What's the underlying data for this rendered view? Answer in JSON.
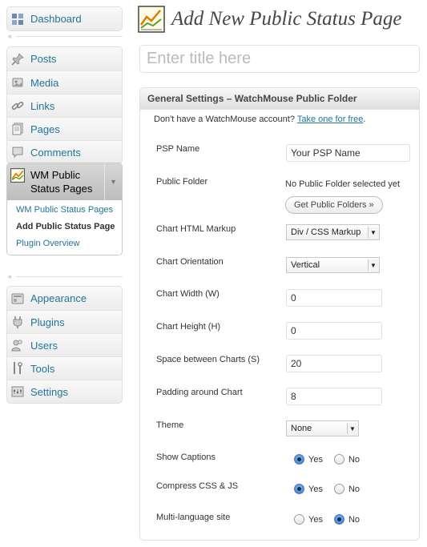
{
  "sidebar": {
    "dashboard": "Dashboard",
    "posts": "Posts",
    "media": "Media",
    "links": "Links",
    "pages": "Pages",
    "comments": "Comments",
    "wm_menu": {
      "label": "WM Public Status Pages",
      "submenu": [
        "WM Public Status Pages",
        "Add Public Status Page",
        "Plugin Overview"
      ],
      "current": "Add Public Status Page"
    },
    "appearance": "Appearance",
    "plugins": "Plugins",
    "users": "Users",
    "tools": "Tools",
    "settings": "Settings"
  },
  "page": {
    "title": "Add New Public Status Page",
    "title_placeholder": "Enter title here"
  },
  "general_settings": {
    "heading": "General Settings – WatchMouse Public Folder",
    "account_note": "Don't have a WatchMouse account?",
    "account_link": "Take one for free",
    "account_suffix": ".",
    "fields": {
      "psp_name": {
        "label": "PSP Name",
        "value": "Your PSP Name"
      },
      "public_folder": {
        "label": "Public Folder",
        "status": "No Public Folder selected yet",
        "button": "Get Public Folders »"
      },
      "chart_markup": {
        "label": "Chart HTML Markup",
        "value": "Div / CSS Markup"
      },
      "chart_orientation": {
        "label": "Chart Orientation",
        "value": "Vertical"
      },
      "chart_width": {
        "label": "Chart Width (W)",
        "value": "0"
      },
      "chart_height": {
        "label": "Chart Height (H)",
        "value": "0"
      },
      "space_between": {
        "label": "Space between Charts (S)",
        "value": "20"
      },
      "padding": {
        "label": "Padding around Chart",
        "value": "8"
      },
      "theme": {
        "label": "Theme",
        "value": "None"
      },
      "show_captions": {
        "label": "Show Captions",
        "yes": "Yes",
        "no": "No",
        "selected": "Yes"
      },
      "compress": {
        "label": "Compress CSS & JS",
        "yes": "Yes",
        "no": "No",
        "selected": "Yes"
      },
      "multilang": {
        "label": "Multi-language site",
        "yes": "Yes",
        "no": "No",
        "selected": "No"
      }
    }
  },
  "colors": {
    "link": "#21759b",
    "active_menu_bg": "#c6c6c6",
    "radio_selected": "#2f6fc6"
  }
}
